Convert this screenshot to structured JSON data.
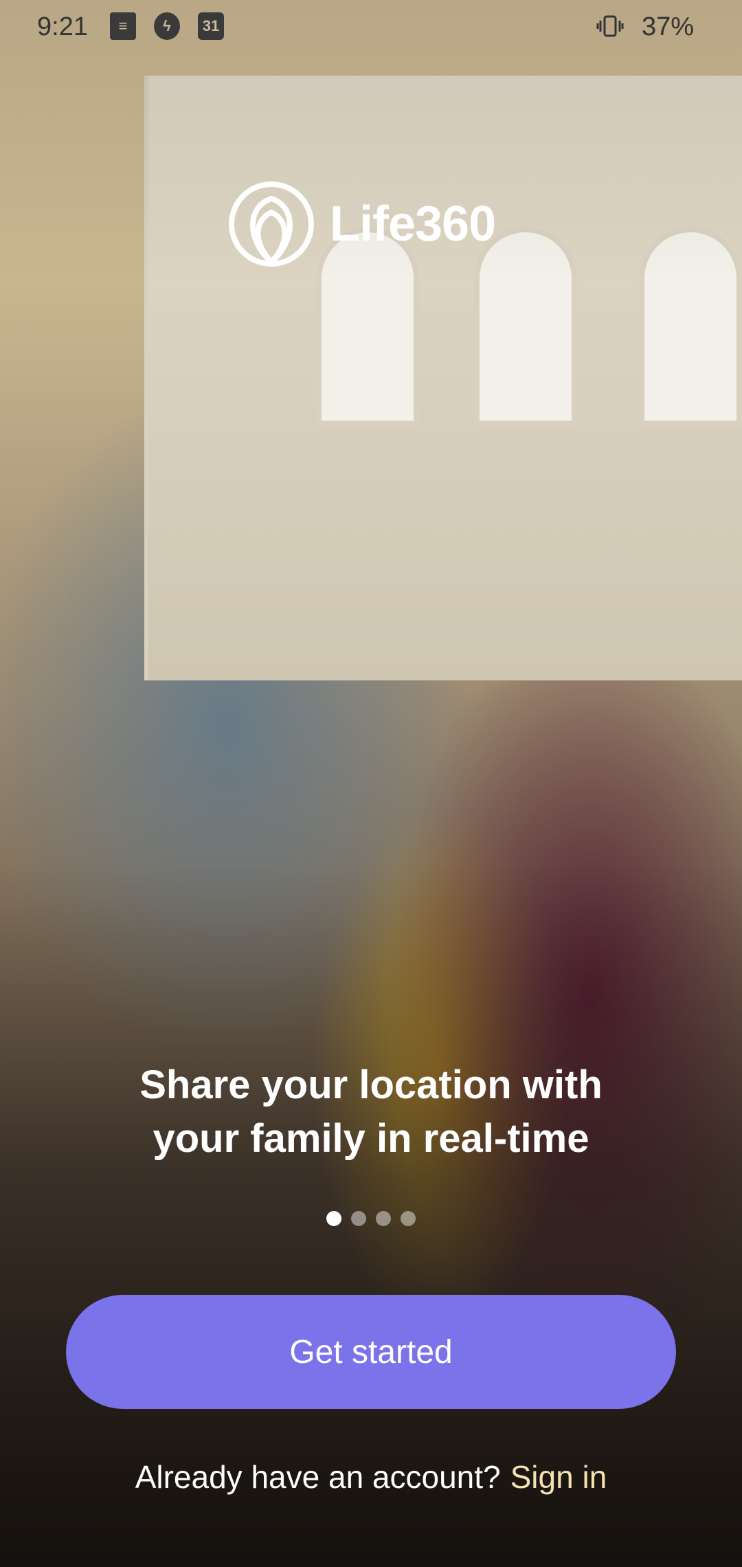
{
  "status_bar": {
    "time": "9:21",
    "icons": [
      "news-icon",
      "messenger-icon",
      "calendar-icon"
    ],
    "calendar_day": "31",
    "vibrate_icon": "vibrate-icon",
    "battery": "37%"
  },
  "brand": {
    "name": "Life360",
    "logo_icon": "life360-logo-icon"
  },
  "onboarding": {
    "headline_line1": "Share your location with",
    "headline_line2": "your family in real-time",
    "pager": {
      "total": 4,
      "active": 1
    }
  },
  "actions": {
    "get_started": "Get started",
    "signin_prompt": "Already have an account?",
    "signin_link": "Sign in"
  },
  "colors": {
    "accent": "#7a73ea",
    "signin_link": "#f4e0b0"
  }
}
